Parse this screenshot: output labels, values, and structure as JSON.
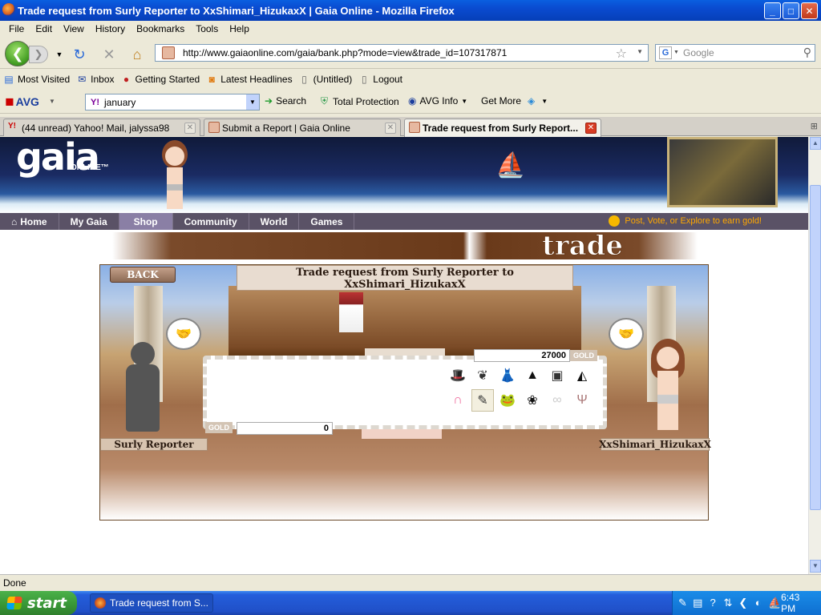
{
  "window": {
    "title": "Trade request from Surly Reporter to XxShimari_HizukaxX | Gaia Online - Mozilla Firefox",
    "buttons": {
      "minimize": "_",
      "maximize": "□",
      "close": "✕"
    }
  },
  "menu": [
    "File",
    "Edit",
    "View",
    "History",
    "Bookmarks",
    "Tools",
    "Help"
  ],
  "nav": {
    "url": "http://www.gaiaonline.com/gaia/bank.php?mode=view&trade_id=107317871",
    "search_placeholder": "Google"
  },
  "bookmarks": [
    {
      "label": "Most Visited",
      "icon": "most-visited-icon"
    },
    {
      "label": "Inbox",
      "icon": "inbox-icon"
    },
    {
      "label": "Getting Started",
      "icon": "getting-started-icon"
    },
    {
      "label": "Latest Headlines",
      "icon": "rss-icon"
    },
    {
      "label": "(Untitled)",
      "icon": "page-icon"
    },
    {
      "label": "Logout",
      "icon": "page-icon"
    }
  ],
  "avg": {
    "logo": "AVG",
    "search_value": "january",
    "search_label": "Search",
    "total_protection": "Total Protection",
    "avg_info": "AVG Info",
    "get_more": "Get More"
  },
  "tabs": [
    {
      "label": "(44 unread) Yahoo! Mail, jalyssa98",
      "active": false
    },
    {
      "label": "Submit a Report | Gaia Online",
      "active": false
    },
    {
      "label": "Trade request from Surly Report...",
      "active": true
    }
  ],
  "gaia": {
    "logo": "gaia",
    "logo_sub": "ONLINE™",
    "nav": [
      "Home",
      "My Gaia",
      "Shop",
      "Community",
      "World",
      "Games"
    ],
    "promo": "Post, Vote, or Explore to earn gold!",
    "trade_banner": "trade",
    "back_button": "BACK",
    "trade_title_line1": "Trade request from Surly Reporter to",
    "trade_title_line2": "XxShimari_HizukaxX",
    "left_user": "Surly Reporter",
    "right_user": "XxShimari_HizukaxX",
    "gold_label": "GOLD",
    "top_gold": "27000",
    "bottom_gold": "0",
    "items": [
      "hat",
      "wings",
      "dress",
      "gown",
      "vest",
      "skirt",
      "earmuffs",
      "brush",
      "frog",
      "rose",
      "glasses",
      "antlers"
    ]
  },
  "status": "Done",
  "taskbar": {
    "start": "start",
    "task": "Trade request from S...",
    "clock": "6:43 PM"
  }
}
